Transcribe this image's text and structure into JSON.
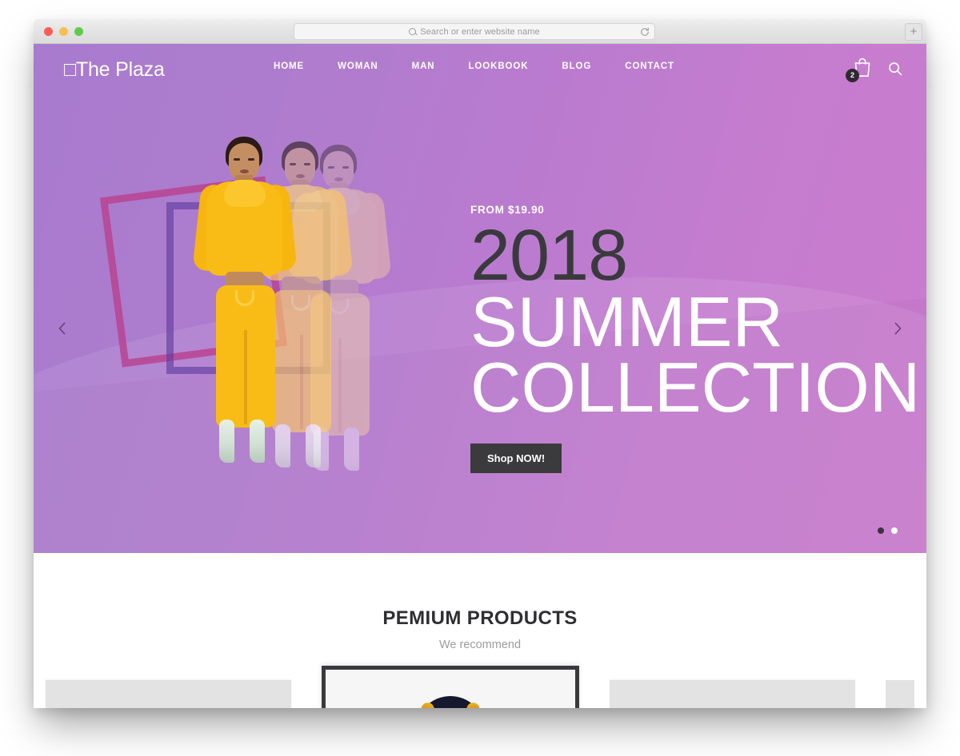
{
  "browser": {
    "traffic_lights": [
      "close",
      "minimize",
      "maximize"
    ],
    "address_placeholder": "Search or enter website name",
    "address_value": "",
    "reload_icon": "reload-icon",
    "new_tab_label": "+"
  },
  "site": {
    "logo": "□The Plaza",
    "nav": [
      {
        "label": "HOME"
      },
      {
        "label": "WOMAN"
      },
      {
        "label": "MAN"
      },
      {
        "label": "LOOKBOOK"
      },
      {
        "label": "BLOG"
      },
      {
        "label": "CONTACT"
      }
    ],
    "cart": {
      "icon": "shopping-bag-icon",
      "count": "2"
    },
    "search": {
      "icon": "search-icon"
    }
  },
  "hero": {
    "kicker": "FROM $19.90",
    "year": "2018",
    "line1": "SUMMER",
    "line2": "COLLECTION",
    "cta": "Shop NOW!",
    "prev_label": "‹",
    "next_label": "›",
    "dots": [
      {
        "state": "active"
      },
      {
        "state": "idle"
      }
    ],
    "colors": {
      "gradient_from": "#a87bcf",
      "gradient_to": "#cb7ccd",
      "year_color": "#3a3a3e",
      "cta_bg": "#3b3a3c",
      "square_pink": "#b8428f",
      "square_purple": "#5e3a9e",
      "outfit": "#f9bc16"
    }
  },
  "products": {
    "title": "PEMIUM PRODUCTS",
    "subtitle": "We recommend",
    "cards": [
      {
        "kind": "placeholder"
      },
      {
        "kind": "featured"
      },
      {
        "kind": "placeholder"
      },
      {
        "kind": "partial"
      }
    ]
  }
}
